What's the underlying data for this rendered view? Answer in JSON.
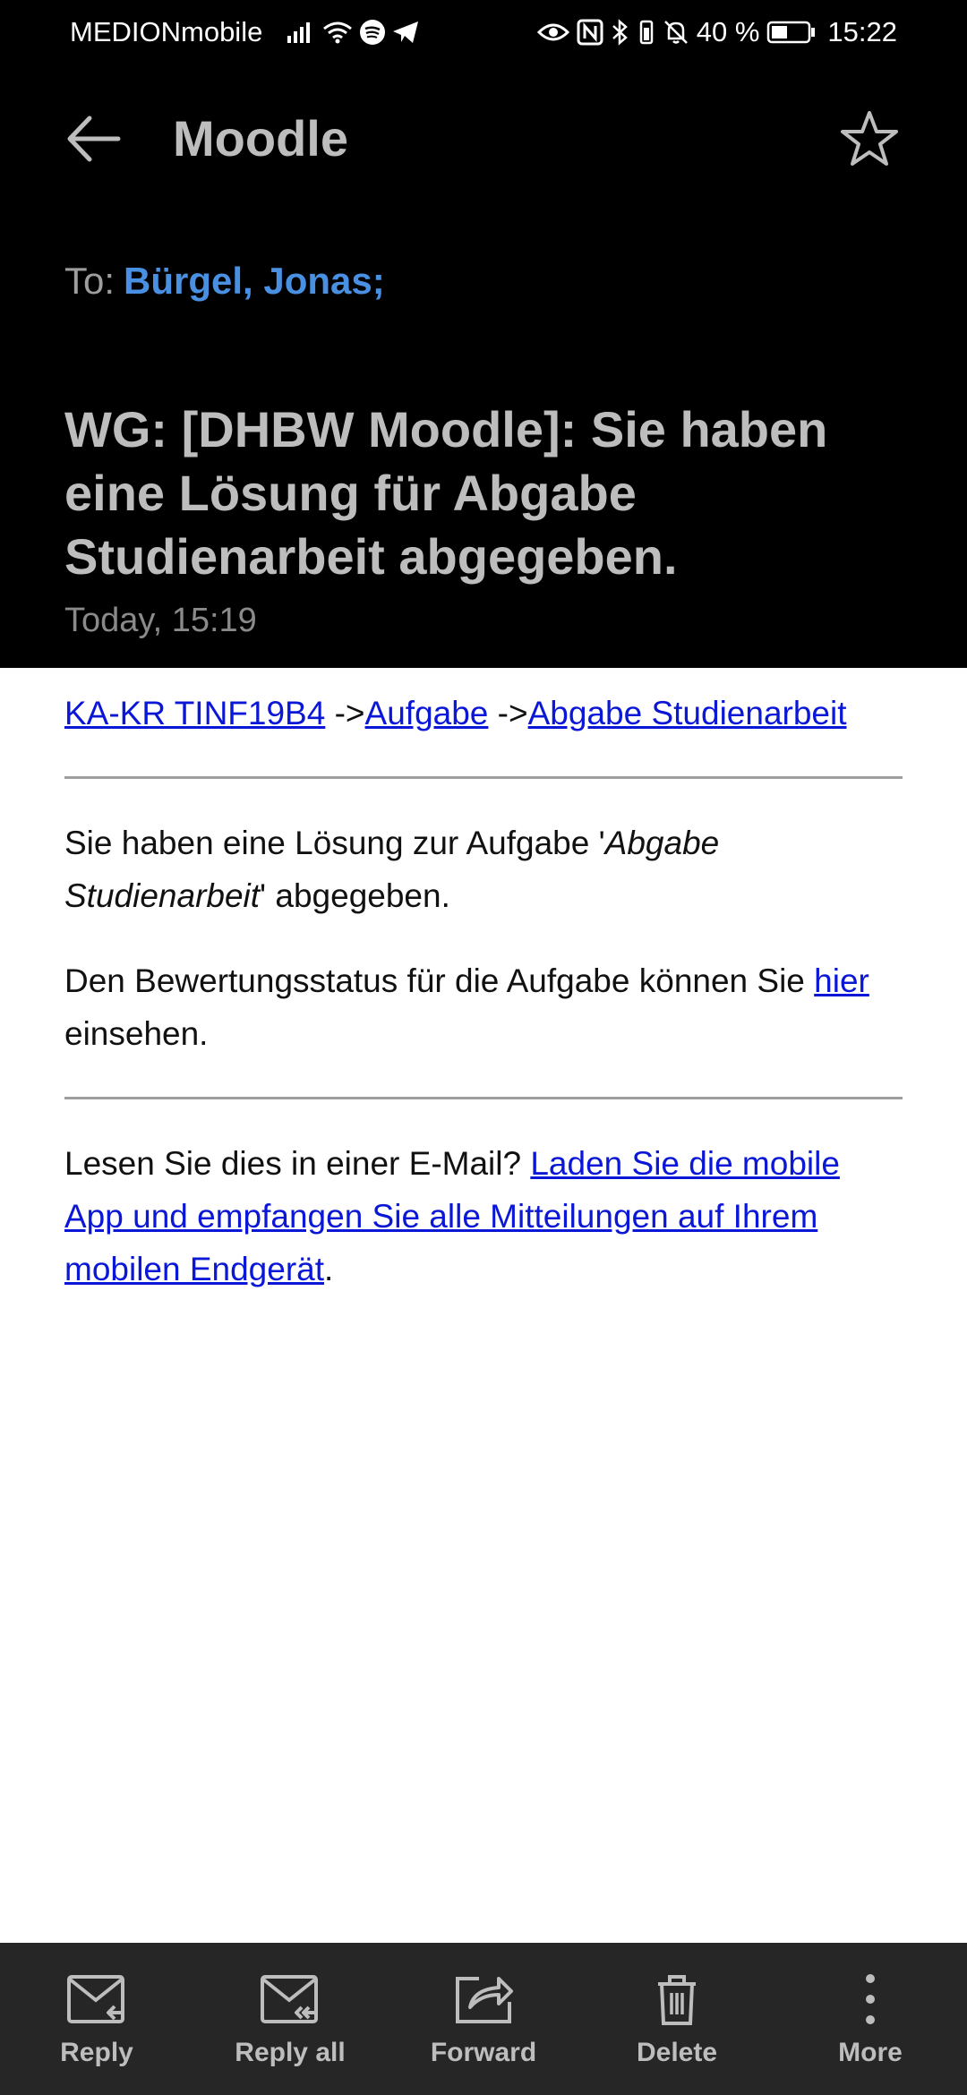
{
  "status_bar": {
    "carrier": "MEDIONmobile",
    "battery_percent": "40 %",
    "time": "15:22",
    "icons_left": [
      "signal-icon",
      "wifi-icon",
      "spotify-icon",
      "telegram-icon"
    ],
    "icons_right": [
      "eye-icon",
      "nfc-icon",
      "bluetooth-icon",
      "vibrate-icon",
      "bell-off-icon",
      "battery-icon"
    ]
  },
  "header": {
    "title": "Moodle",
    "to_label": "To:",
    "to_value": "Bürgel, Jonas;",
    "subject": "WG: [DHBW Moodle]: Sie haben eine Lösung für Abgabe Studienarbeit abgegeben.",
    "date": "Today, 15:19"
  },
  "body": {
    "breadcrumb": {
      "link1": "KA-KR TINF19B4",
      "sep1": " ->",
      "link2": "Aufgabe",
      "sep2": " ->",
      "link3": "Abgabe Studienarbeit"
    },
    "para1": {
      "prefix": "Sie haben eine Lösung zur Aufgabe '",
      "italic": "Abgabe Studienarbeit",
      "suffix": "' abgegeben."
    },
    "para2": {
      "prefix": "Den Bewertungsstatus für die Aufgabe können Sie ",
      "link": "hier",
      "suffix": " einsehen."
    },
    "para3": {
      "prefix": "Lesen Sie dies in einer E-Mail? ",
      "link": "Laden Sie die mobile App und empfangen Sie alle Mitteilungen auf Ihrem mobilen Endgerät",
      "suffix": "."
    }
  },
  "actions": {
    "reply": "Reply",
    "reply_all": "Reply all",
    "forward": "Forward",
    "delete": "Delete",
    "more": "More"
  },
  "colors": {
    "header_bg": "#000000",
    "accent": "#4a90e2",
    "link": "#0b17d6",
    "bottom_bar": "#262626"
  }
}
